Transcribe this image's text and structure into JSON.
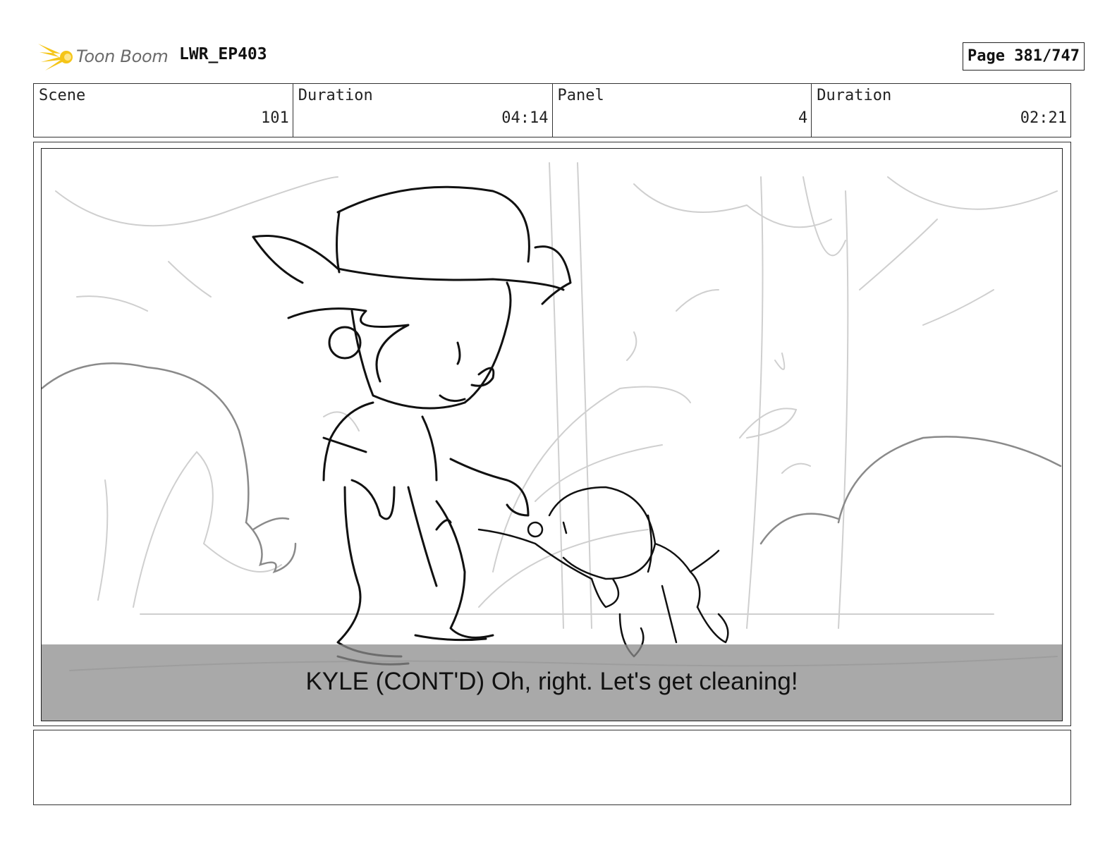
{
  "header": {
    "logo_text": "Toon Boom",
    "project": "LWR_EP403",
    "page": "Page 381/747"
  },
  "info": {
    "scene_label": "Scene",
    "scene_value": "101",
    "scene_duration_label": "Duration",
    "scene_duration_value": "04:14",
    "panel_label": "Panel",
    "panel_value": "4",
    "panel_duration_label": "Duration",
    "panel_duration_value": "02:21"
  },
  "panel": {
    "caption": "KYLE (CONT'D) Oh, right. Let's get cleaning!"
  },
  "notes": {
    "text": ""
  },
  "colors": {
    "logo_flame": "#f5c518",
    "caption_bar": "#8c8c8c"
  }
}
